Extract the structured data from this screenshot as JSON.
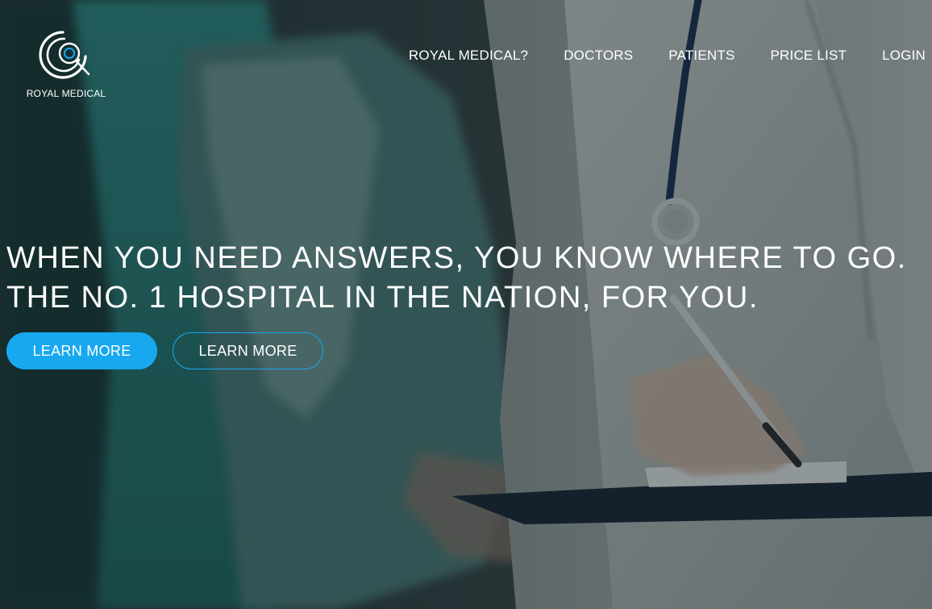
{
  "brand": {
    "name": "ROYAL MEDICAL",
    "accent_color": "#17a8f0"
  },
  "nav": {
    "items": [
      {
        "label": "ROYAL MEDICAL?"
      },
      {
        "label": "DOCTORS"
      },
      {
        "label": "PATIENTS"
      },
      {
        "label": "PRICE LIST"
      },
      {
        "label": "LOGIN"
      }
    ]
  },
  "hero": {
    "headline_line1": "WHEN YOU NEED ANSWERS, YOU KNOW WHERE TO GO.",
    "headline_line2": "THE NO. 1 HOSPITAL IN THE NATION, FOR YOU.",
    "primary_button_label": "LEARN MORE",
    "secondary_button_label": "LEARN MORE"
  }
}
